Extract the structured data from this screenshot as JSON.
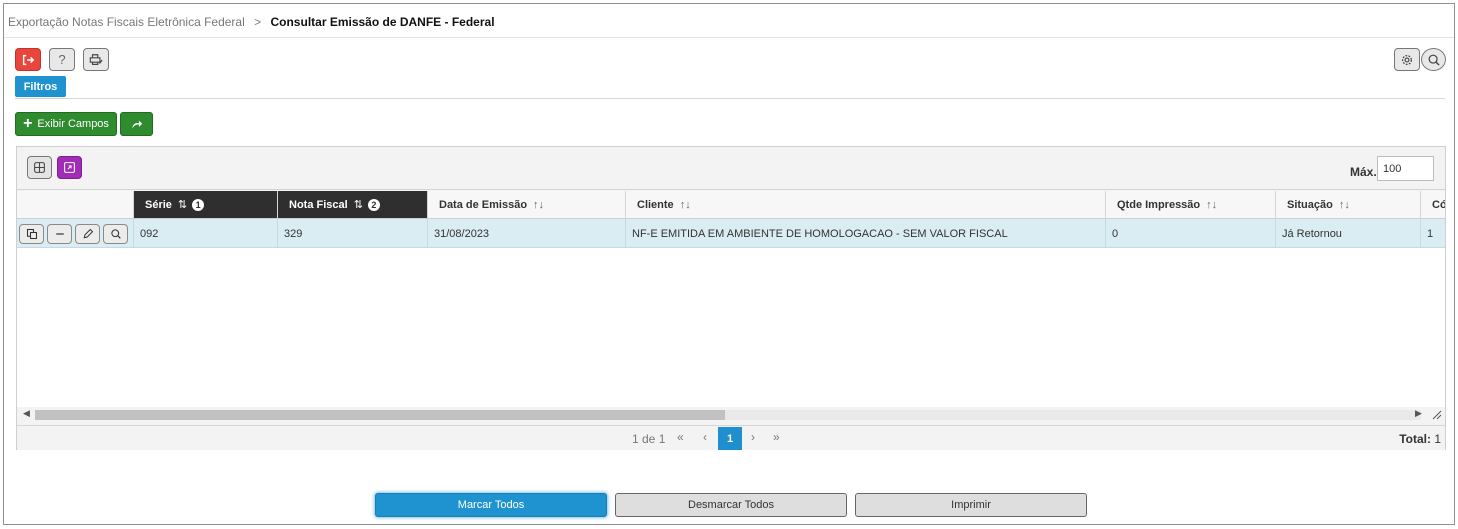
{
  "breadcrumb": {
    "parent": "Exportação Notas Fiscais Eletrônica Federal",
    "separator": ">",
    "current": "Consultar Emissão de DANFE - Federal"
  },
  "toolbar": {
    "exit_title": "Sair",
    "help_label": "?",
    "print_title": "Imprimir",
    "settings_title": "Configurações",
    "search_title": "Pesquisar"
  },
  "filters_tab": "Filtros",
  "actions": {
    "show_fields": "Exibir Campos"
  },
  "grid": {
    "max_label": "Máx.",
    "max_value": "100",
    "columns": [
      {
        "label": "Série",
        "sort": "⇅",
        "order": "1"
      },
      {
        "label": "Nota Fiscal",
        "sort": "⇅",
        "order": "2"
      },
      {
        "label": "Data de Emissão",
        "sort": "↑↓"
      },
      {
        "label": "Cliente",
        "sort": "↑↓"
      },
      {
        "label": "Qtde Impressão",
        "sort": "↑↓"
      },
      {
        "label": "Situação",
        "sort": "↑↓"
      },
      {
        "label": "Cód"
      }
    ],
    "rows": [
      {
        "serie": "092",
        "nota_fiscal": "329",
        "data_emissao": "31/08/2023",
        "cliente": "NF-E EMITIDA EM AMBIENTE DE HOMOLOGACAO - SEM VALOR FISCAL",
        "qtde_impressao": "0",
        "situacao": "Já Retornou",
        "cod": "1"
      }
    ]
  },
  "pager": {
    "info": "1 de 1",
    "first": "«",
    "prev": "‹",
    "current_page": "1",
    "next": "›",
    "last": "»",
    "total_label": "Total:",
    "total_value": "1"
  },
  "footer": {
    "select_all": "Marcar Todos",
    "deselect_all": "Desmarcar Todos",
    "print": "Imprimir"
  },
  "colors": {
    "primary": "#1f93cf",
    "green": "#2e8b2e",
    "danger": "#e8453c",
    "purple": "#a12cb5",
    "selected_row": "#d9edf2",
    "header_dark": "#2f2f2f"
  }
}
